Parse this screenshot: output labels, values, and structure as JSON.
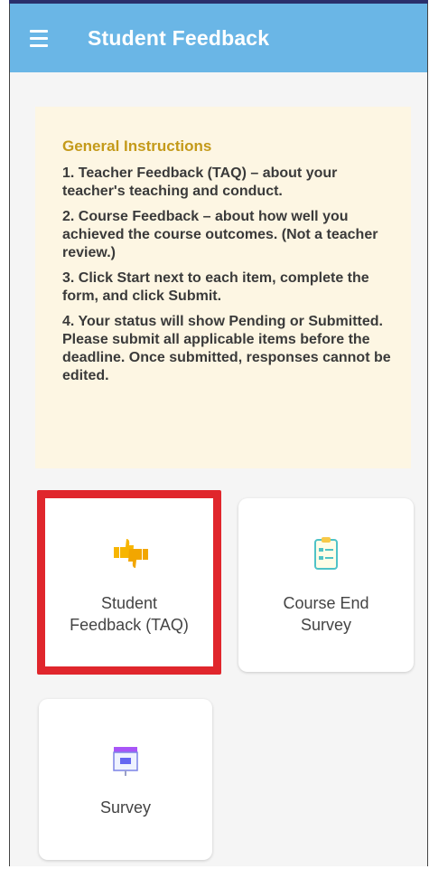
{
  "app": {
    "title": "Student Feedback",
    "menu_icon": "hamburger-menu-icon",
    "header_color": "#6ab6e6"
  },
  "instructions": {
    "heading": "General Instructions",
    "items": [
      "1. Teacher Feedback (TAQ) – about your teacher's teaching and conduct.",
      "2. Course Feedback – about how well you achieved the course outcomes. (Not a teacher review.)",
      "3. Click Start next to each item, complete the form, and click Submit.",
      "4. Your status will show Pending or Submitted. Please submit all applicable items before the deadline. Once submitted, responses cannot be edited."
    ]
  },
  "tiles": [
    {
      "label_line1": "Student",
      "label_line2": "Feedback (TAQ)",
      "icon": "thumbs-up-down-icon",
      "highlighted": true,
      "highlight_color": "#e0262c"
    },
    {
      "label_line1": "Course End",
      "label_line2": "Survey",
      "icon": "clipboard-checklist-icon"
    },
    {
      "label_line1": "Survey",
      "icon": "presentation-board-icon"
    }
  ]
}
